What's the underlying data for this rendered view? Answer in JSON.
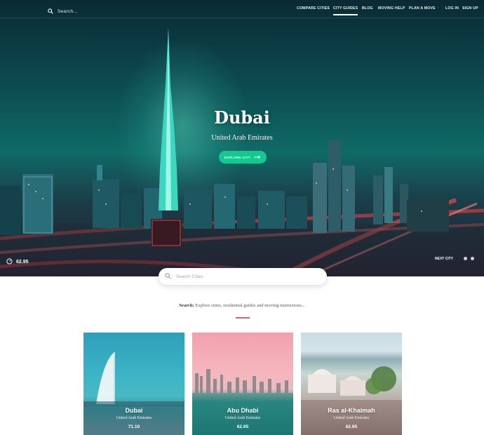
{
  "nav": {
    "search_label": "Search...",
    "links": [
      "COMPARE CITIES",
      "CITY GUIDES",
      "BLOG",
      "MOVING HELP",
      "PLAN A MOVE"
    ],
    "separator": "·",
    "login": "LOG IN",
    "signup": "SIGN UP",
    "active_link": "CITY GUIDES"
  },
  "hero": {
    "city": "Dubai",
    "country": "United Arab Emirates",
    "explore_label": "EXPLORE CITY",
    "score": "62.95",
    "next_label": "NEXT CITY"
  },
  "search": {
    "placeholder": "Search Cities",
    "help_prefix": "Search:",
    "help_text": "Explore cities, residential guides and moving instructions..."
  },
  "cards": [
    {
      "name": "Dubai",
      "country": "United Arab Emirates",
      "score": "71.10"
    },
    {
      "name": "Abu Dhabi",
      "country": "United Arab Emirates",
      "score": "62.95"
    },
    {
      "name": "Ras al-Khaimah",
      "country": "United Arab Emirates",
      "score": "62.95"
    }
  ],
  "colors": {
    "accent": "#14c98e",
    "divider": "#e2606a"
  }
}
